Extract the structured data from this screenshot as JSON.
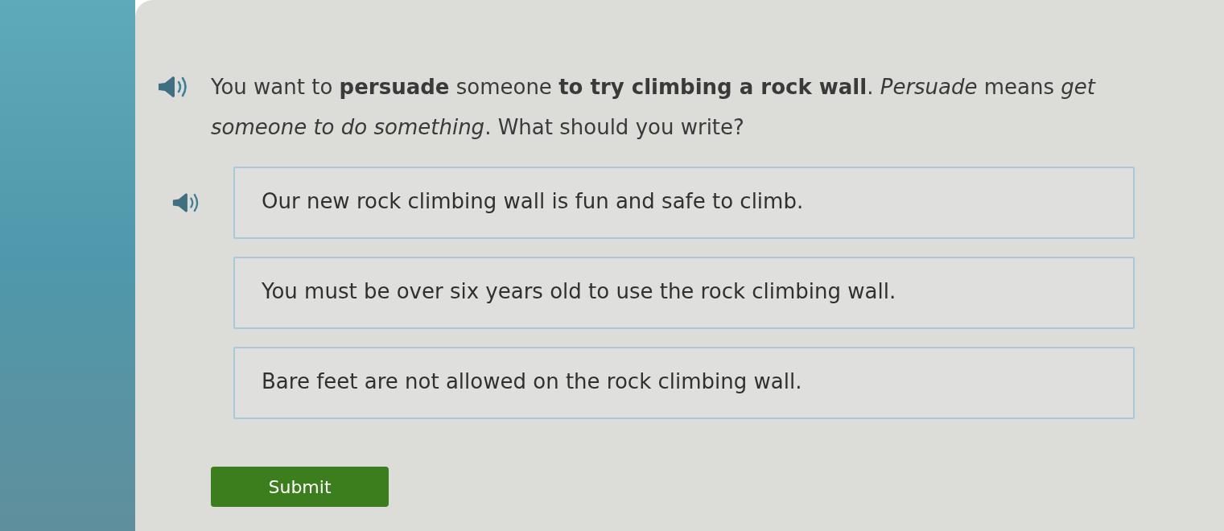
{
  "question": {
    "text": "You want to **persuade** someone **to try climbing a rock wall**. *Persuade* means *get someone to do something*. What should you write?"
  },
  "options": [
    {
      "text": "Our new rock climbing wall is fun and safe to climb.",
      "selected": false,
      "audio_icon": true
    },
    {
      "text": "You must be over six years old to use the rock climbing wall.",
      "selected": false,
      "audio_icon": false
    },
    {
      "text": "Bare feet are not allowed on the rock climbing wall.",
      "selected": false,
      "audio_icon": false
    }
  ],
  "submit": {
    "label": "Submit"
  }
}
